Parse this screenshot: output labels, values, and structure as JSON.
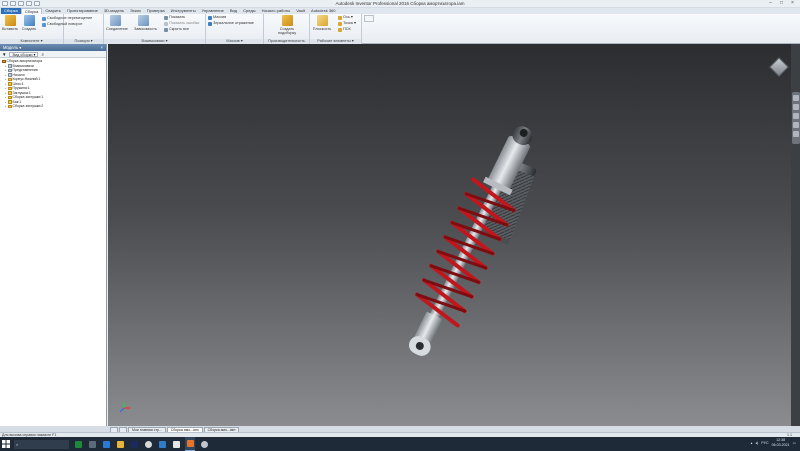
{
  "window": {
    "title": "Autodesk Inventor Professional 2016  Сборка амортизатора.iam",
    "controls": [
      "–",
      "□",
      "×"
    ]
  },
  "ribbon": {
    "tabs": [
      {
        "label": "Сборка",
        "active": false,
        "file": true
      },
      {
        "label": "Сборка",
        "active": true
      },
      {
        "label": "Сварить"
      },
      {
        "label": "Проектирование"
      },
      {
        "label": "3D-модель"
      },
      {
        "label": "Эскиз"
      },
      {
        "label": "Проверка"
      },
      {
        "label": "Инструменты"
      },
      {
        "label": "Управление"
      },
      {
        "label": "Вид"
      },
      {
        "label": "Среды"
      },
      {
        "label": "Начало работы"
      },
      {
        "label": "Vault"
      },
      {
        "label": "Autodesk 360"
      }
    ],
    "panels": {
      "component": {
        "title": "Компонент ▾",
        "insert": "Вставить",
        "create": "Создать",
        "pattern": "Свободное перемещение",
        "rotate": "Свободный поворот"
      },
      "position": {
        "title": "Позиция ▾"
      },
      "relations": {
        "title": "Взаимосвязи ▾",
        "join": "Соединение",
        "constrain": "Зависимость",
        "show": "Показать",
        "show_sick": "Показать ошибки",
        "hide_all": "Скрыть все"
      },
      "manage": {
        "title": "Массив ▾",
        "mirror": "Массив",
        "replace": "Зеркальное отражение"
      },
      "productivity": {
        "title": "Производительность",
        "create_sub": "Создать подсборку"
      },
      "work": {
        "title": "Рабочие элементы ▾",
        "plane": "Плоскость",
        "axis": "Ось ▾",
        "point": "Точка ▾",
        "ucs": "ПСК"
      }
    }
  },
  "browser": {
    "title": "Модель ▾",
    "close": "×",
    "view_mode": "Вид сборки ▾",
    "items": [
      {
        "label": "Сборка амортизатора",
        "level": 0,
        "root": true
      },
      {
        "label": "Взаимосвязи",
        "level": 1,
        "group": true
      },
      {
        "label": "Представления",
        "level": 1,
        "group": true
      },
      {
        "label": "Начало",
        "level": 1,
        "group": true
      },
      {
        "label": "Корпус:Нижний:1",
        "level": 1
      },
      {
        "label": "Шток:1",
        "level": 1
      },
      {
        "label": "Пружина:1",
        "level": 1
      },
      {
        "label": "Заглушка:1",
        "level": 1
      },
      {
        "label": "Сборка заглушки:1",
        "level": 1
      },
      {
        "label": "Бак:1",
        "level": 1
      },
      {
        "label": "Сборка заглушки:2",
        "level": 1
      }
    ]
  },
  "documents": {
    "tabs": [
      {
        "label": "Мои главная стр..."
      },
      {
        "label": "Сборка амо...iam",
        "active": true
      },
      {
        "label": "Сборка амо...iam"
      }
    ]
  },
  "status": {
    "text": "Для вызова справки нажмите F1",
    "right": "1      1"
  },
  "taskbar": {
    "search": "",
    "clock_time": "12:38",
    "clock_date": "06.03.2021",
    "lang": "РУС"
  },
  "colors": {
    "spring": "#c2161c",
    "viewport_top": "#2b2d30",
    "viewport_bottom": "#8a8c90",
    "accent": "#2d6fb8"
  }
}
